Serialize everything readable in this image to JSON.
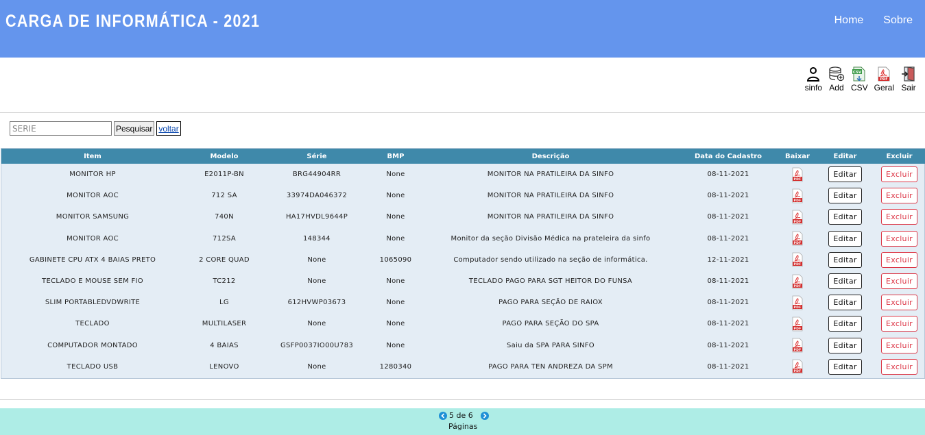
{
  "header": {
    "brand": "CARGA DE INFORMÁTICA - 2021",
    "nav": [
      "Home",
      "Sobre"
    ]
  },
  "toolbar": [
    {
      "label": "sinfo",
      "icon": "user-icon"
    },
    {
      "label": "Add",
      "icon": "database-add-icon"
    },
    {
      "label": "CSV",
      "icon": "csv-file-icon"
    },
    {
      "label": "Geral",
      "icon": "pdf-file-icon"
    },
    {
      "label": "Sair",
      "icon": "exit-icon"
    }
  ],
  "search": {
    "placeholder": "SERIE",
    "button": "Pesquisar",
    "back": "voltar"
  },
  "table": {
    "columns": [
      "Item",
      "Modelo",
      "Série",
      "BMP",
      "Descrição",
      "Data do Cadastro",
      "Baixar",
      "Editar",
      "Excluir"
    ],
    "edit_label": "Editar",
    "delete_label": "Excluir",
    "rows": [
      [
        "MONITOR HP",
        "E2011P-BN",
        "BRG44904RR",
        "None",
        "MONITOR NA PRATILEIRA DA SINFO",
        "08-11-2021"
      ],
      [
        "MONITOR AOC",
        "712 SA",
        "33974DA046372",
        "None",
        "MONITOR NA PRATILEIRA DA SINFO",
        "08-11-2021"
      ],
      [
        "MONITOR SAMSUNG",
        "740N",
        "HA17HVDL9644P",
        "None",
        "MONITOR NA PRATILEIRA DA SINFO",
        "08-11-2021"
      ],
      [
        "MONITOR AOC",
        "712SA",
        "148344",
        "None",
        "Monitor da seção Divisão Médica na prateleira da sinfo",
        "08-11-2021"
      ],
      [
        "GABINETE CPU ATX 4 BAIAS PRETO",
        "2 CORE QUAD",
        "None",
        "1065090",
        "Computador sendo utilizado na seção de informática.",
        "12-11-2021"
      ],
      [
        "TECLADO E MOUSE SEM FIO",
        "TC212",
        "None",
        "None",
        "TECLADO PAGO PARA SGT HEITOR DO FUNSA",
        "08-11-2021"
      ],
      [
        "SLIM PORTABLEDVDWRITE",
        "LG",
        "612HVWP03673",
        "None",
        "PAGO PARA SEÇÃO DE RAIOX",
        "08-11-2021"
      ],
      [
        "TECLADO",
        "MULTILASER",
        "None",
        "None",
        "PAGO PARA SEÇÃO DO SPA",
        "08-11-2021"
      ],
      [
        "COMPUTADOR MONTADO",
        "4 BAIAS",
        "GSFP0037IO00U783",
        "None",
        "Saiu da SPA PARA SINFO",
        "08-11-2021"
      ],
      [
        "TECLADO USB",
        "LENOVO",
        "None",
        "1280340",
        "PAGO PARA TEN ANDREZA DA SPM",
        "08-11-2021"
      ]
    ]
  },
  "pagination": {
    "info": "5 de 6",
    "label": "Páginas"
  },
  "colors": {
    "header_bg": "#6495ed",
    "table_header_bg": "#3f89aa",
    "table_body_bg": "#e4edf5",
    "footer_bg": "#aeede6",
    "delete_red": "#dc3545"
  }
}
